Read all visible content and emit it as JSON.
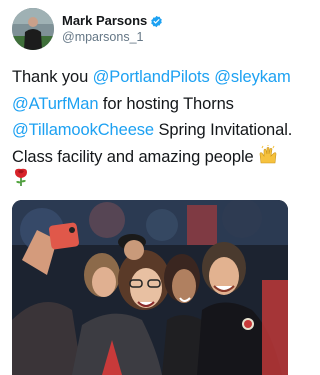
{
  "author": {
    "display_name": "Mark Parsons",
    "handle": "@mparsons_1",
    "verified": true
  },
  "tweet": {
    "segments": [
      {
        "type": "text",
        "value": "Thank you "
      },
      {
        "type": "mention",
        "value": "@PortlandPilots"
      },
      {
        "type": "text",
        "value": " "
      },
      {
        "type": "mention",
        "value": "@sleykam"
      },
      {
        "type": "text",
        "value": " "
      },
      {
        "type": "mention",
        "value": "@ATurfMan"
      },
      {
        "type": "text",
        "value": " for hosting Thorns "
      },
      {
        "type": "mention",
        "value": "@TillamookCheese"
      },
      {
        "type": "text",
        "value": " Spring Invitational. Class facility and amazing people "
      }
    ],
    "emojis": [
      "raised-hands-emoji",
      "rose-emoji"
    ]
  },
  "media": {
    "type": "photo",
    "icons": [
      "selfie-photo"
    ]
  },
  "colors": {
    "link": "#1da1f2",
    "verified": "#1da1f2",
    "text": "#14171a",
    "secondary": "#657786"
  }
}
